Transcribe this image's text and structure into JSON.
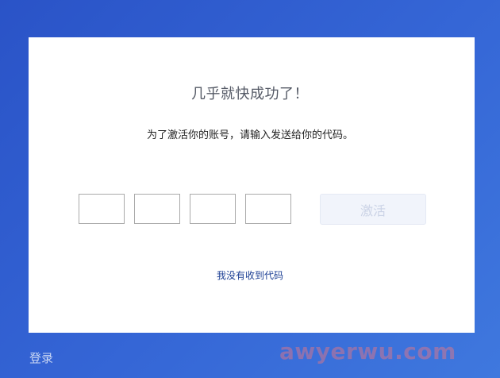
{
  "dialog": {
    "title": "几乎就快成功了！",
    "subtitle": "为了激活你的账号，请输入发送给你的代码。",
    "code_inputs": [
      "",
      "",
      "",
      ""
    ],
    "activate_label": "激活",
    "resend_label": "我没有收到代码"
  },
  "footer": {
    "login_label": "登录"
  },
  "watermark": {
    "text": "awyerwu.com"
  }
}
